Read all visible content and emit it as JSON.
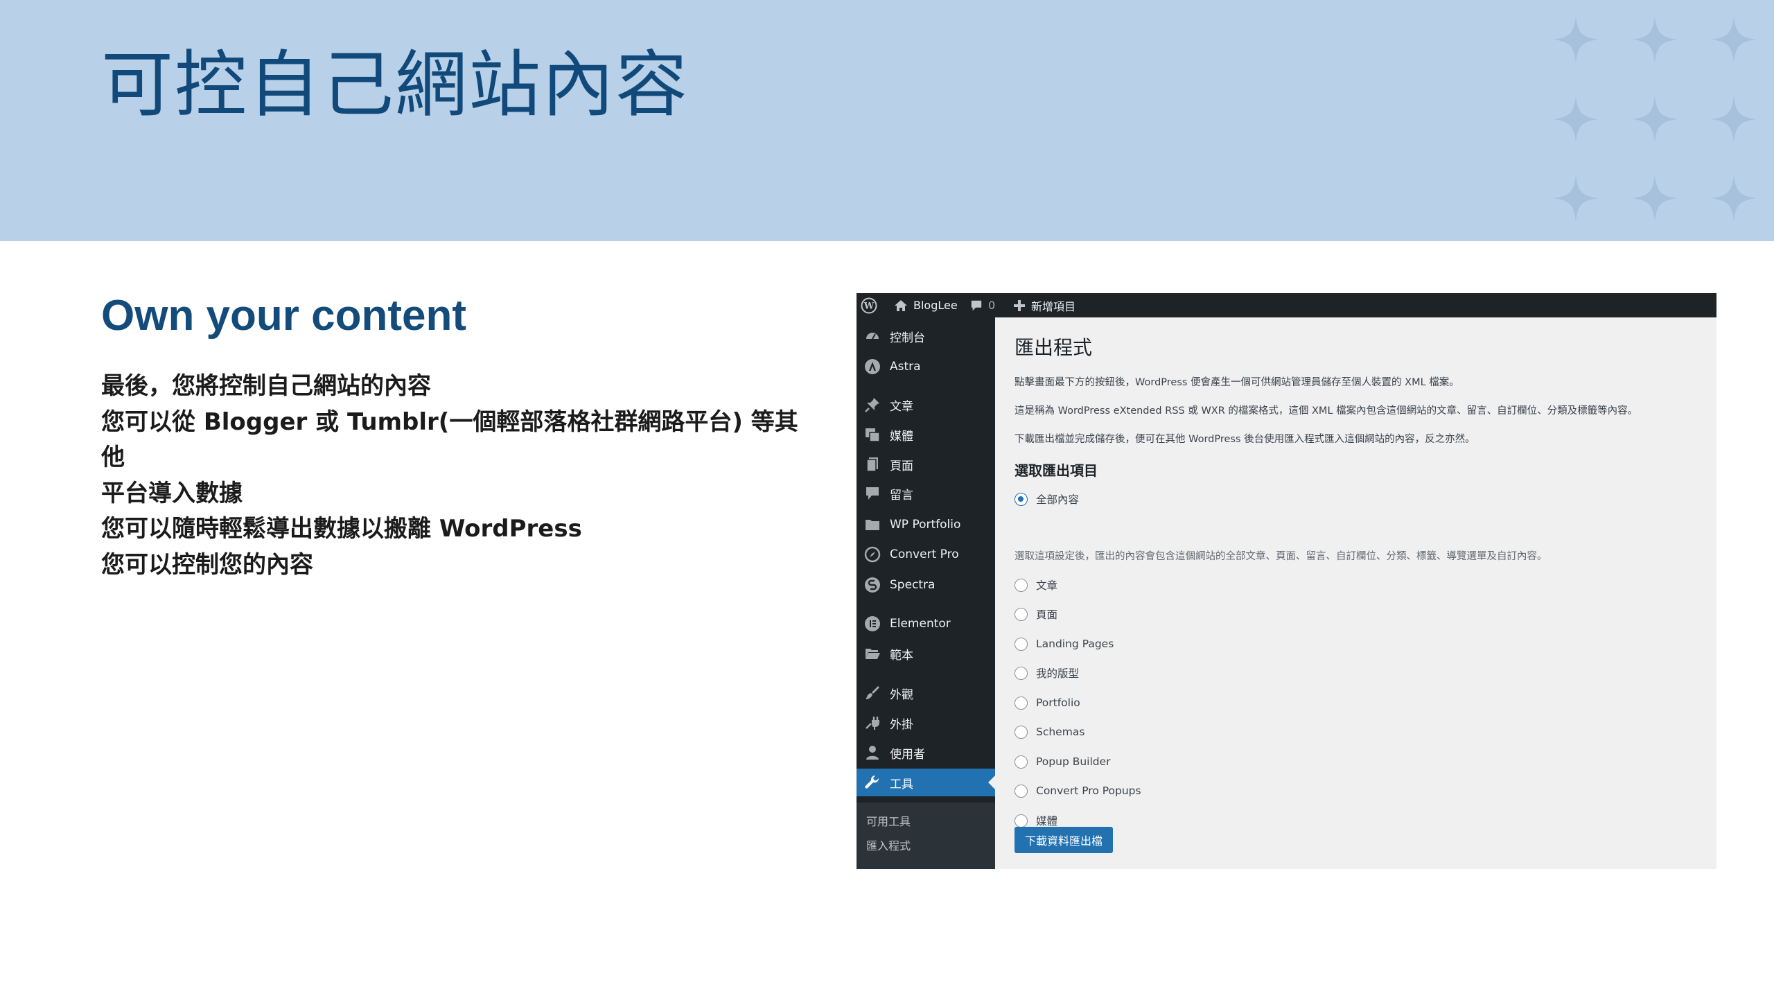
{
  "slide": {
    "title": "可控自己網站內容",
    "subtitle": "Own your content",
    "body_lines": [
      "最後，您將控制自己網站的內容",
      "您可以從 Blogger 或 Tumblr(一個輕部落格社群網路平台) 等其他",
      "平台導入數據",
      "您可以隨時輕鬆導出數據以搬離 WordPress",
      "您可以控制您的內容"
    ],
    "colors": {
      "header_band": "#b8d0e8",
      "title": "#114a7a",
      "star": "#a7c1dc"
    },
    "decoration_icon": "four-point-star-icon"
  },
  "wp": {
    "adminbar": {
      "wp_logo_icon": "wordpress-logo-icon",
      "site_icon": "home-icon",
      "site_name": "BlogLee",
      "comments_icon": "comment-bubble-icon",
      "comments_count": "0",
      "new_icon": "plus-icon",
      "new_label": "新增項目"
    },
    "sidebar": {
      "items": [
        {
          "label": "控制台",
          "icon": "dashboard-icon"
        },
        {
          "label": "Astra",
          "icon": "astra-icon"
        },
        {
          "label": "文章",
          "icon": "pin-icon"
        },
        {
          "label": "媒體",
          "icon": "media-icon"
        },
        {
          "label": "頁面",
          "icon": "page-icon"
        },
        {
          "label": "留言",
          "icon": "comment-icon"
        },
        {
          "label": "WP Portfolio",
          "icon": "folder-icon"
        },
        {
          "label": "Convert Pro",
          "icon": "compass-icon"
        },
        {
          "label": "Spectra",
          "icon": "spectra-icon"
        },
        {
          "label": "Elementor",
          "icon": "elementor-icon"
        },
        {
          "label": "範本",
          "icon": "folder-open-icon"
        },
        {
          "label": "外觀",
          "icon": "brush-icon"
        },
        {
          "label": "外掛",
          "icon": "plug-icon"
        },
        {
          "label": "使用者",
          "icon": "user-icon"
        },
        {
          "label": "工具",
          "icon": "wrench-icon"
        }
      ],
      "current": "工具",
      "submenu": [
        "可用工具",
        "匯入程式"
      ],
      "colors": {
        "bg": "#1d2327",
        "current": "#2271b1"
      }
    },
    "export": {
      "title": "匯出程式",
      "paragraphs": [
        "點擊畫面最下方的按鈕後，WordPress 便會產生一個可供網站管理員儲存至個人裝置的 XML 檔案。",
        "這是稱為 WordPress eXtended RSS 或 WXR 的檔案格式，這個 XML 檔案內包含這個網站的文章、留言、自訂欄位、分類及標籤等內容。",
        "下載匯出檔並完成儲存後，便可在其他 WordPress 後台使用匯入程式匯入這個網站的內容，反之亦然。"
      ],
      "section_heading": "選取匯出項目",
      "options": [
        "全部內容",
        "文章",
        "頁面",
        "Landing Pages",
        "我的版型",
        "Portfolio",
        "Schemas",
        "Popup Builder",
        "Convert Pro Popups",
        "媒體"
      ],
      "selected": "全部內容",
      "all_content_description": "選取這項設定後，匯出的內容會包含這個網站的全部文章、頁面、留言、自訂欄位、分類、標籤、導覽選單及自訂內容。",
      "download_button": "下載資料匯出檔"
    }
  }
}
